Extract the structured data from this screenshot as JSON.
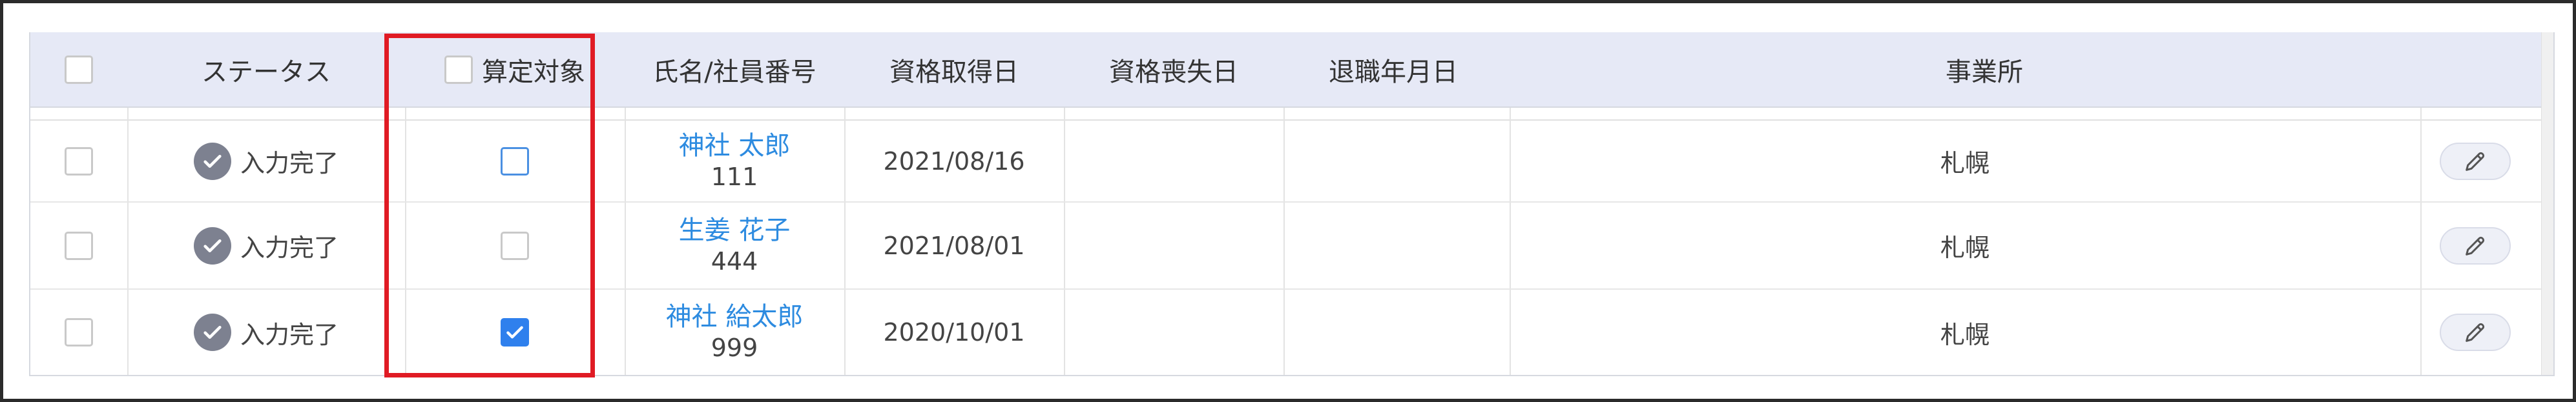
{
  "table": {
    "columns": {
      "status": "ステータス",
      "calc_target": "算定対象",
      "name_id": "氏名/社員番号",
      "acquired": "資格取得日",
      "lost": "資格喪失日",
      "retire": "退職年月日",
      "office": "事業所"
    },
    "rows": [
      {
        "status": "入力完了",
        "name": "神社 太郎",
        "id": "111",
        "acquired": "2021/08/16",
        "lost": "",
        "retire": "",
        "office": "札幌",
        "calc_target_checked": false
      },
      {
        "status": "入力完了",
        "name": "生姜 花子",
        "id": "444",
        "acquired": "2021/08/01",
        "lost": "",
        "retire": "",
        "office": "札幌",
        "calc_target_checked": false
      },
      {
        "status": "入力完了",
        "name": "神社 給太郎",
        "id": "999",
        "acquired": "2020/10/01",
        "lost": "",
        "retire": "",
        "office": "札幌",
        "calc_target_checked": true
      }
    ]
  },
  "colors": {
    "header_bg": "#e6e9f6",
    "link": "#2d8be0",
    "checkbox_checked": "#2f80ed",
    "highlight": "#e01b24",
    "status_icon": "#7d8190"
  }
}
